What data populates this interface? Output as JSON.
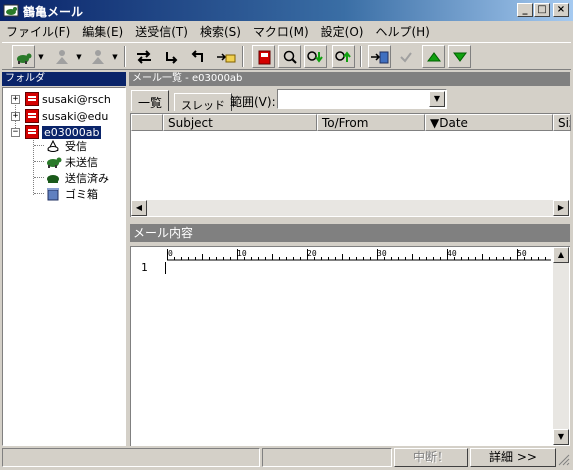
{
  "app": {
    "title": "鶴亀メール"
  },
  "menubar": [
    "ファイル(F)",
    "編集(E)",
    "送受信(T)",
    "検索(S)",
    "マクロ(M)",
    "設定(O)",
    "ヘルプ(H)"
  ],
  "colors": {
    "titlebar": "#0a246a",
    "selection": "#0a246a",
    "account_icon": "#d40000",
    "arrow_green": "#10a010"
  },
  "folders": {
    "header": "フォルダ",
    "accounts": [
      "susaki@rsch",
      "susaki@edu",
      "e03000ab"
    ],
    "subfolders": [
      "受信",
      "未送信",
      "送信済み",
      "ゴミ箱"
    ]
  },
  "list": {
    "header": "メール一覧 - e03000ab",
    "tabs": [
      "一覧",
      "スレッド"
    ],
    "range_label": "範囲(V):",
    "range_value": "",
    "columns": [
      "",
      "Subject",
      "To/From",
      "▼Date",
      "Siz"
    ]
  },
  "content": {
    "header": "メール内容",
    "ruler": [
      "0",
      "10",
      "20",
      "30",
      "40",
      "50"
    ],
    "line_number": "1"
  },
  "status": {
    "interrupt": "中断！",
    "details": "詳細 >>"
  }
}
